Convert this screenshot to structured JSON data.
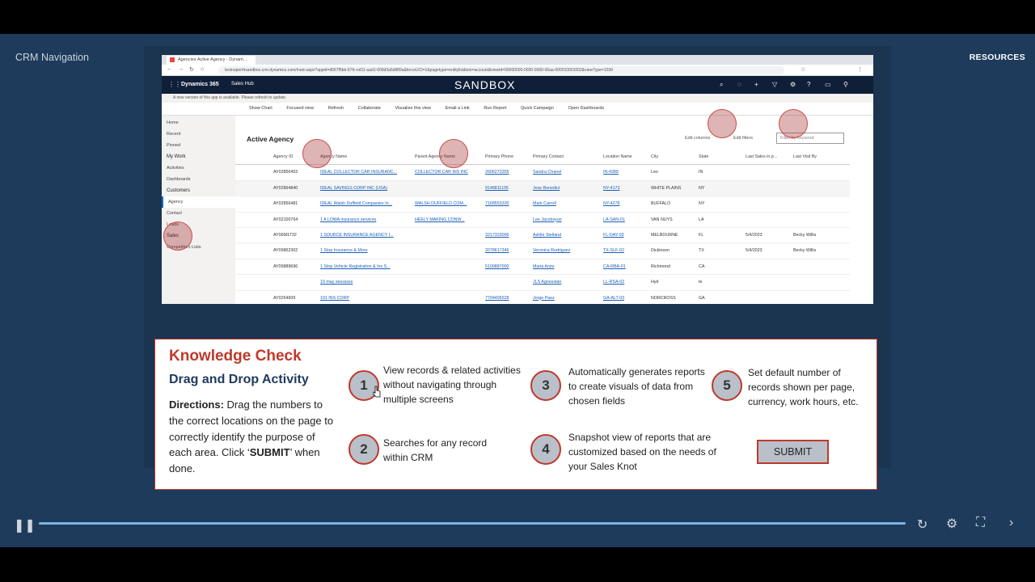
{
  "player": {
    "course_title": "CRM Navigation",
    "resources_label": "RESOURCES",
    "progress_fraction": 1.0,
    "icons": [
      "pause-icon",
      "replay-icon",
      "settings-icon",
      "fullscreen-icon",
      "next-icon"
    ]
  },
  "browser": {
    "tab_title": "Agencies Active Agency - Dynam...",
    "url": "textnoperrhsandbox.crm.dynamics.com/main.aspx?appid=d567f5bb-67fc-ed11-aad1-000d3a5d889a&forceUCI=1&pagetype=entitylist&etn=account&viewid=00000000-0000-0000-00aa-000010001002&viewType=1039"
  },
  "crm": {
    "brand": "Dynamics 365",
    "app_name": "Sales Hub",
    "environment": "SANDBOX",
    "notice": "A new version of this app is available. Please refresh to update.",
    "commands": [
      "Show Chart",
      "Focused view",
      "Refresh",
      "Collaborate",
      "Visualize this view",
      "Email a Link",
      "Run Report",
      "Quick Campaign",
      "Open Dashboards"
    ],
    "sidebar": [
      {
        "label": "Home",
        "group": false
      },
      {
        "label": "Recent",
        "group": false
      },
      {
        "label": "Pinned",
        "group": false
      },
      {
        "label": "My Work",
        "group": true
      },
      {
        "label": "Activities",
        "group": false
      },
      {
        "label": "Dashboards",
        "group": false
      },
      {
        "label": "Customers",
        "group": true
      },
      {
        "label": "Agency",
        "group": false,
        "active": true
      },
      {
        "label": "Contact",
        "group": false
      },
      {
        "label": "Leads",
        "group": false
      },
      {
        "label": "Sales",
        "group": true
      },
      {
        "label": "Competitors Lists",
        "group": false
      }
    ],
    "view_title": "Active Agency",
    "edit_columns": "Edit columns",
    "edit_filters": "Edit filters",
    "filter_placeholder": "Filter by keyword",
    "columns": [
      "Agency ID",
      "Agency Name",
      "Parent Agency Name",
      "Primary Phone",
      "Primary Contact",
      "Location Name",
      "City",
      "State",
      "Last Sales in p...",
      "Last Visit By"
    ],
    "rows": [
      [
        "AY02856453",
        "IDEAL COLLECTOR CAR INSURANC...",
        "COLLECTOR CAR INS INC",
        "2606273355",
        "Sandra Chanel",
        "IN-4389",
        "Leo",
        "IN",
        "",
        ""
      ],
      [
        "AY02864840",
        "IDEAL SAVINGS CORP INC (USA)",
        "",
        "9148811105",
        "Jose Benedict",
        "NY-4173",
        "WHITE PLAINS",
        "NY",
        "",
        ""
      ],
      [
        "AY02856481",
        "IDEAL Walsh Duffield Companies In...",
        "WALSH DUFFIELD COM...",
        "7168553320",
        "Mark Carroll",
        "NY-4278",
        "BUFFALO",
        "NY",
        "",
        ""
      ],
      [
        "AY02100764",
        "1 A LOWA insurance services",
        "HEELY MAKING CONW...",
        "",
        "Lee Jacobsyun",
        "LA-SAN-01",
        "VAN NUYS",
        "LA",
        "",
        ""
      ],
      [
        "AY06M1732",
        "1 SOURCE INSURANCE AGENCY I...",
        "",
        "3217323006",
        "Ashlie Stelland",
        "FL-DAY-03",
        "MELBOURNE",
        "FL",
        "5/4/2023",
        "Becky Willis"
      ],
      [
        "AY09862302",
        "1 Stop Insurance & More",
        "",
        "2078617346",
        "Veronica Rodriguez",
        "TX-SLF-02",
        "Dickinson",
        "TX",
        "5/4/2023",
        "Becky Willis"
      ],
      [
        "AY09889696",
        "1 Stop Vehicle Registration & Ins S...",
        "",
        "5109887000",
        "Maria Anze",
        "CA-RBA-01",
        "Richmond",
        "CA",
        "",
        ""
      ],
      [
        "",
        "10 may sessssss",
        "",
        "",
        "JLS Agnesstan",
        "LL-RSA-02",
        "Hyd",
        "te",
        "",
        ""
      ],
      [
        "AY0264609",
        "101 INS CORP",
        "",
        "7704405528",
        "Jorge Paez",
        "GA-ALT-03",
        "NORCROSS",
        "GA",
        "",
        ""
      ]
    ]
  },
  "knowledge_check": {
    "title": "Knowledge Check",
    "subtitle": "Drag and Drop Activity",
    "directions_label": "Directions:",
    "directions_text": " Drag the numbers to the correct locations on the page to correctly identify the purpose of each area. Click ‘",
    "directions_submit_word": "SUBMIT",
    "directions_end": "’ when done.",
    "items": [
      {
        "number": "1",
        "text": "View records & related activities without navigating through multiple screens"
      },
      {
        "number": "2",
        "text": "Searches for any record within CRM"
      },
      {
        "number": "3",
        "text": "Automatically generates reports to create visuals of data from chosen fields"
      },
      {
        "number": "4",
        "text": "Snapshot view of reports that are customized based on the needs of your Sales Knot"
      },
      {
        "number": "5",
        "text": "Set default number of records shown per page, currency, work hours, etc."
      }
    ],
    "submit_label": "SUBMIT"
  }
}
